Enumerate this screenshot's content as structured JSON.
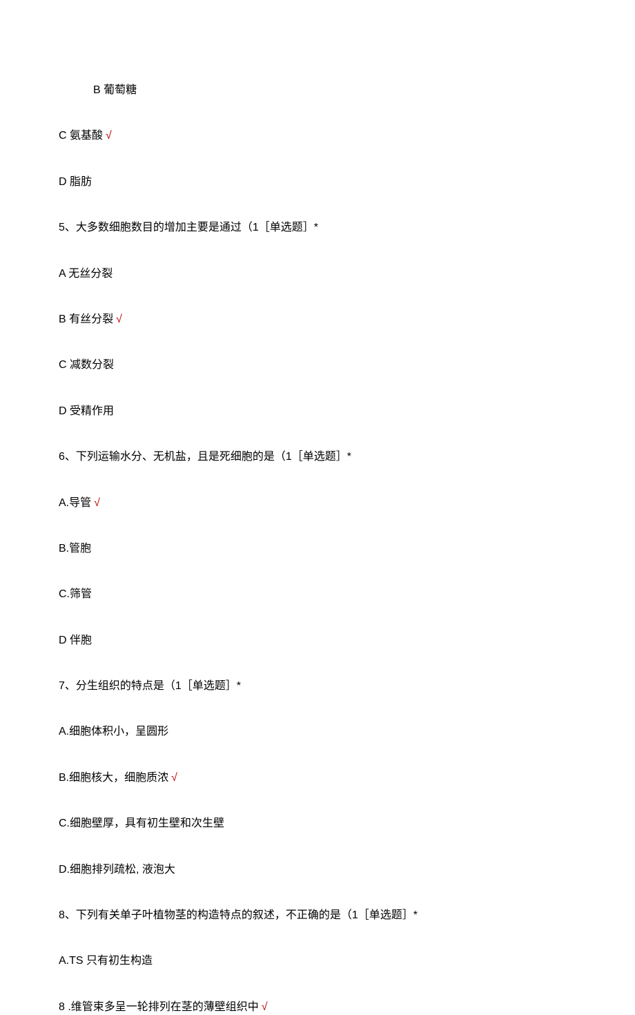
{
  "lines": [
    {
      "text": "B 葡萄糖",
      "correct": false,
      "indent": true
    },
    {
      "text": "C 氨基酸",
      "correct": true,
      "indent": false
    },
    {
      "text": "D 脂肪",
      "correct": false,
      "indent": false
    },
    {
      "text": "5、大多数细胞数目的增加主要是通过（1［单选题］*",
      "correct": false,
      "indent": false
    },
    {
      "text": "A 无丝分裂",
      "correct": false,
      "indent": false
    },
    {
      "text": "B 有丝分裂",
      "correct": true,
      "indent": false
    },
    {
      "text": "C 减数分裂",
      "correct": false,
      "indent": false
    },
    {
      "text": "D 受精作用",
      "correct": false,
      "indent": false
    },
    {
      "text": "6、下列运输水分、无机盐，且是死细胞的是（1［单选题］*",
      "correct": false,
      "indent": false
    },
    {
      "text": "A.导管",
      "correct": true,
      "indent": false
    },
    {
      "text": "B.管胞",
      "correct": false,
      "indent": false
    },
    {
      "text": "C.筛管",
      "correct": false,
      "indent": false
    },
    {
      "text": "D 伴胞",
      "correct": false,
      "indent": false
    },
    {
      "text": "7、分生组织的特点是（1［单选题］*",
      "correct": false,
      "indent": false
    },
    {
      "text": "A.细胞体积小，呈圆形",
      "correct": false,
      "indent": false
    },
    {
      "text": "B.细胞核大，细胞质浓",
      "correct": true,
      "indent": false
    },
    {
      "text": "C.细胞壁厚，具有初生壁和次生壁",
      "correct": false,
      "indent": false
    },
    {
      "text": "D.细胞排列疏松, 液泡大",
      "correct": false,
      "indent": false
    },
    {
      "text": "8、下列有关单子叶植物茎的构造特点的叙述，不正确的是（1［单选题］*",
      "correct": false,
      "indent": false
    },
    {
      "text": "A.TS 只有初生构造",
      "correct": false,
      "indent": false
    },
    {
      "text": "8    .维管束多呈一轮排列在茎的薄壁组织中",
      "correct": true,
      "indent": false
    }
  ],
  "checkmark": "√"
}
